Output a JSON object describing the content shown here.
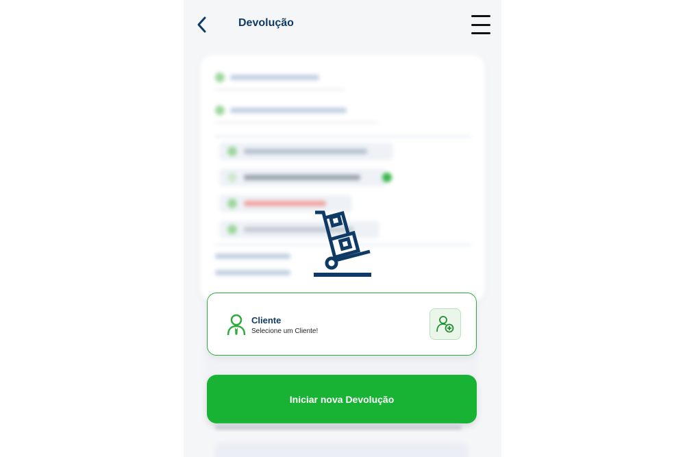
{
  "header": {
    "title": "Devolução",
    "back_icon": "chevron-left-icon",
    "menu_icon": "hamburger-menu-icon"
  },
  "center_icon": "hand-truck-boxes-icon",
  "client": {
    "title": "Cliente",
    "subtitle": "Selecione um Cliente!",
    "icon": "user-icon",
    "add_icon": "add-user-icon"
  },
  "actions": {
    "start_label": "Iniciar nova Devolução"
  },
  "colors": {
    "brand_blue": "#0f3a66",
    "brand_green": "#18b334",
    "border_green": "#2eaa3d",
    "background": "#f5f6f8"
  }
}
